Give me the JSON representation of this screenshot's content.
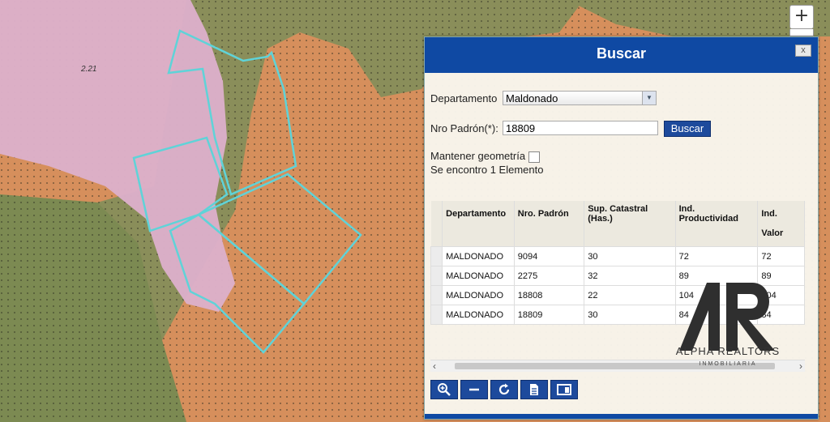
{
  "map": {
    "parcel_label": "2.21",
    "zoom_in_label": "+"
  },
  "dialog": {
    "title": "Buscar",
    "close_label": "x",
    "departamento_label": "Departamento",
    "departamento_value": "Maldonado",
    "padron_label": "Nro Padrón(*):",
    "padron_value": "18809",
    "search_button": "Buscar",
    "mantener_label": "Mantener geometría",
    "result_text": "Se encontro 1 Elemento",
    "columns": [
      "Departamento",
      "Nro. Padrón",
      "Sup. Catastral (Has.)",
      "Ind. Productividad",
      "Ind. Valor"
    ],
    "rows": [
      [
        "MALDONADO",
        "9094",
        "30",
        "72",
        "72"
      ],
      [
        "MALDONADO",
        "2275",
        "32",
        "89",
        "89"
      ],
      [
        "MALDONADO",
        "18808",
        "22",
        "104",
        "104"
      ],
      [
        "MALDONADO",
        "18809",
        "30",
        "84",
        "84"
      ]
    ]
  },
  "watermark": {
    "name": "ALPHA REALTORS",
    "sub": "INMOBILIARIA"
  },
  "colors": {
    "header_blue": "#0f49a3",
    "parcel_outline": "#5fd3d8",
    "pink_zone": "#dba7c4",
    "green_zone": "#7f8a55",
    "orange_zone": "#d68f5c"
  }
}
